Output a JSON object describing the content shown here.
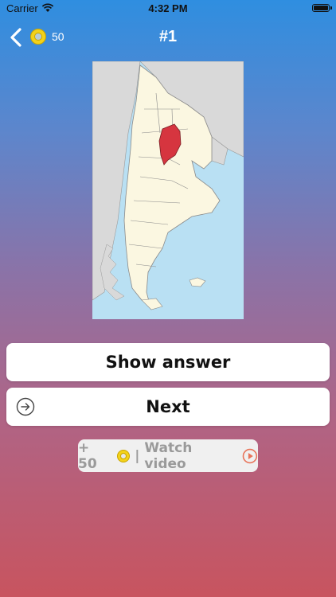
{
  "status_bar": {
    "carrier": "Carrier",
    "time": "4:32 PM"
  },
  "nav": {
    "coins": "50",
    "question_number": "#1"
  },
  "map": {
    "highlight_color": "#d6353f",
    "land_color": "#fbf7e1",
    "sea_color": "#b9e0f3",
    "neighbor_color": "#d9d9d9"
  },
  "buttons": {
    "show_answer": "Show answer",
    "next": "Next"
  },
  "reward": {
    "amount": "+ 50",
    "separator": "|",
    "label": "Watch video"
  },
  "icons": {
    "back": "chevron-left-icon",
    "coin": "coin-icon",
    "next": "arrow-circle-right-icon",
    "play": "play-circle-icon"
  }
}
